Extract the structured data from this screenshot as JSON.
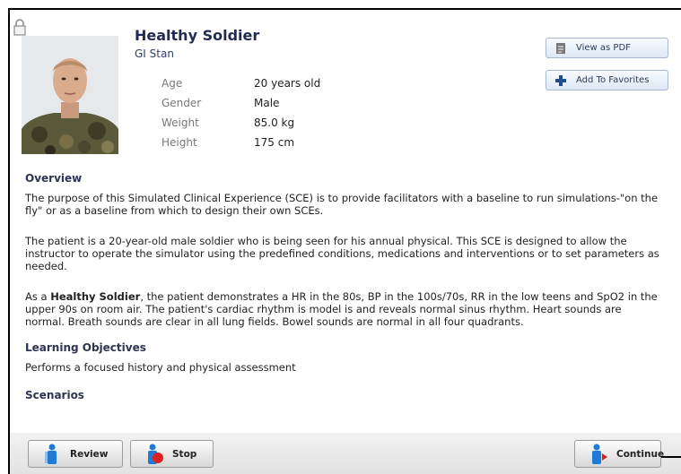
{
  "patient": {
    "name": "Healthy Soldier",
    "subname": "GI Stan",
    "fields": [
      {
        "label": "Age",
        "value": "20 years old"
      },
      {
        "label": "Gender",
        "value": "Male"
      },
      {
        "label": "Weight",
        "value": "85.0 kg"
      },
      {
        "label": "Height",
        "value": "175 cm"
      }
    ]
  },
  "actions": {
    "pdf_label": "View as PDF",
    "favorites_label": "Add To Favorites"
  },
  "overview": {
    "title": "Overview",
    "para1": "The purpose of this Simulated Clinical Experience (SCE) is to provide facilitators with a baseline to run simulations-\"on the fly\" or as a baseline from which to design their own SCEs.",
    "para2": "The patient is a 20-year-old male soldier who is being seen for his annual physical. This SCE is designed to allow the instructor to operate the simulator using the predefined conditions, medications and interventions or to set parameters as needed.",
    "para3_prefix": "As a ",
    "para3_bold": "Healthy Soldier",
    "para3_rest": ", the patient demonstrates a HR in the 80s, BP in the 100s/70s, RR in the low teens and SpO2 in the upper 90s on room air. The patient's cardiac rhythm is model is and reveals normal sinus rhythm. Heart sounds are normal. Breath sounds are clear in all lung fields. Bowel sounds are normal in all four quadrants."
  },
  "learning": {
    "title": "Learning Objectives",
    "text": "Performs a focused history and physical assessment"
  },
  "scenarios": {
    "title": "Scenarios"
  },
  "footer": {
    "review_label": "Review",
    "stop_label": "Stop",
    "continue_label": "Continue"
  },
  "colors": {
    "border": "#000000",
    "accent_blue": "#1f7bd6",
    "stop_red": "#e02020",
    "continue_red": "#d81e1e"
  }
}
